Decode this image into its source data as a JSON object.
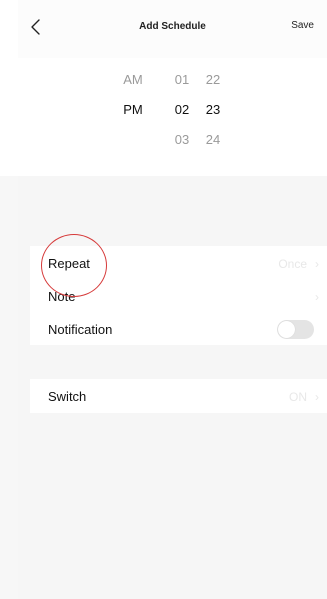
{
  "header": {
    "title": "Add Schedule",
    "save_label": "Save"
  },
  "picker": {
    "ampm": {
      "above": "AM",
      "selected": "PM",
      "below": ""
    },
    "hour": {
      "above": "01",
      "selected": "02",
      "below": "03"
    },
    "minute": {
      "above": "22",
      "selected": "23",
      "below": "24"
    }
  },
  "settings": {
    "repeat": {
      "label": "Repeat",
      "value": "Once"
    },
    "note": {
      "label": "Note",
      "value": ""
    },
    "notification": {
      "label": "Notification",
      "enabled": false
    },
    "switch": {
      "label": "Switch",
      "value": "ON"
    }
  },
  "icons": {
    "back": "chevron-left-icon",
    "row_arrow": "chevron-right-icon"
  },
  "colors": {
    "selected_text": "#111111",
    "dim_text": "#9a9a9a",
    "faded_value": "#e8e8e8",
    "annotation_circle": "#d63a3a"
  }
}
